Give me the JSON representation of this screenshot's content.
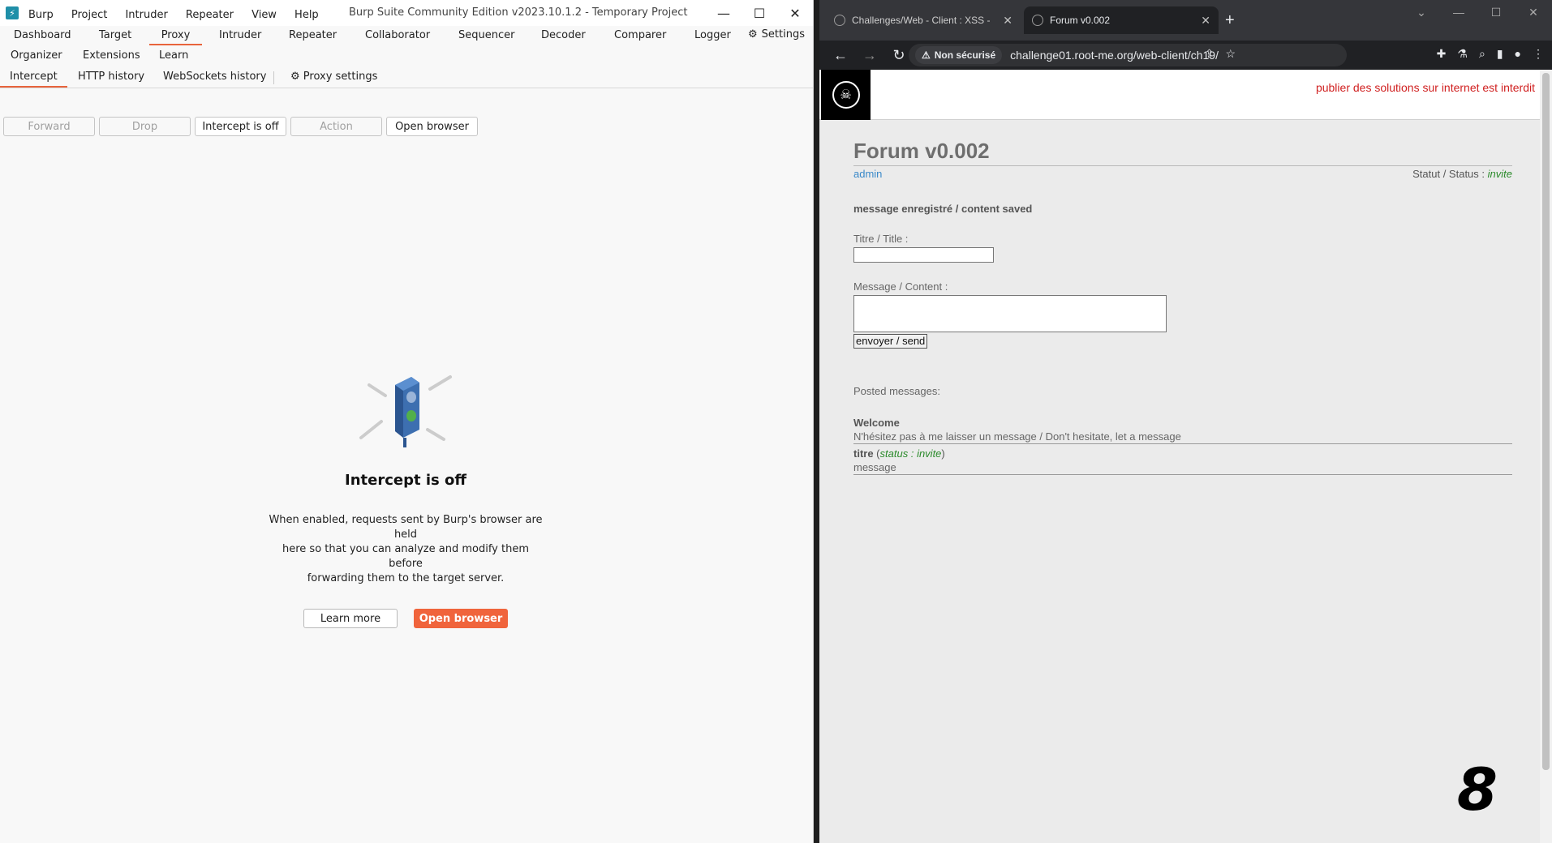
{
  "burp": {
    "title": "Burp Suite Community Edition v2023.10.1.2 - Temporary Project",
    "menu": [
      "Burp",
      "Project",
      "Intruder",
      "Repeater",
      "View",
      "Help"
    ],
    "tabs_row1": [
      "Dashboard",
      "Target",
      "Proxy",
      "Intruder",
      "Repeater",
      "Collaborator",
      "Sequencer",
      "Decoder",
      "Comparer",
      "Logger"
    ],
    "tabs_row2": [
      "Organizer",
      "Extensions",
      "Learn"
    ],
    "active_tab": "Proxy",
    "settings_label": "Settings",
    "subtabs": [
      "Intercept",
      "HTTP history",
      "WebSockets history"
    ],
    "proxy_settings_label": "Proxy settings",
    "toolbar": {
      "forward": "Forward",
      "drop": "Drop",
      "intercept": "Intercept is off",
      "action": "Action",
      "open_browser": "Open browser"
    },
    "empty": {
      "heading": "Intercept is off",
      "line1": "When enabled, requests sent by Burp's browser are held",
      "line2": "here so that you can analyze and modify them before",
      "line3": "forwarding them to the target server.",
      "learn_more": "Learn more",
      "open_browser": "Open browser"
    },
    "colors": {
      "accent": "#f0643c"
    }
  },
  "chrome": {
    "tabs": [
      {
        "title": "Challenges/Web - Client : XSS -",
        "active": false
      },
      {
        "title": "Forum v0.002",
        "active": true
      }
    ],
    "insecure_label": "Non sécurisé",
    "url": "challenge01.root-me.org/web-client/ch19/"
  },
  "site": {
    "warning": "publier des solutions sur internet est interdit",
    "forum_title": "Forum v0.002",
    "user": "admin",
    "status_label": "Statut / Status :",
    "status_value": "invite",
    "saved_msg": "message enregistré / content saved",
    "title_label": "Titre / Title :",
    "message_label": "Message / Content :",
    "send_label": "envoyer / send",
    "posted_label": "Posted messages:",
    "posts": [
      {
        "title": "Welcome",
        "body": "N'hésitez pas à me laisser un message / Don't hesitate, let a message"
      },
      {
        "title": "titre",
        "status_prefix": "status :",
        "status": "invite",
        "body": "message"
      }
    ],
    "overlay_number": "8"
  }
}
